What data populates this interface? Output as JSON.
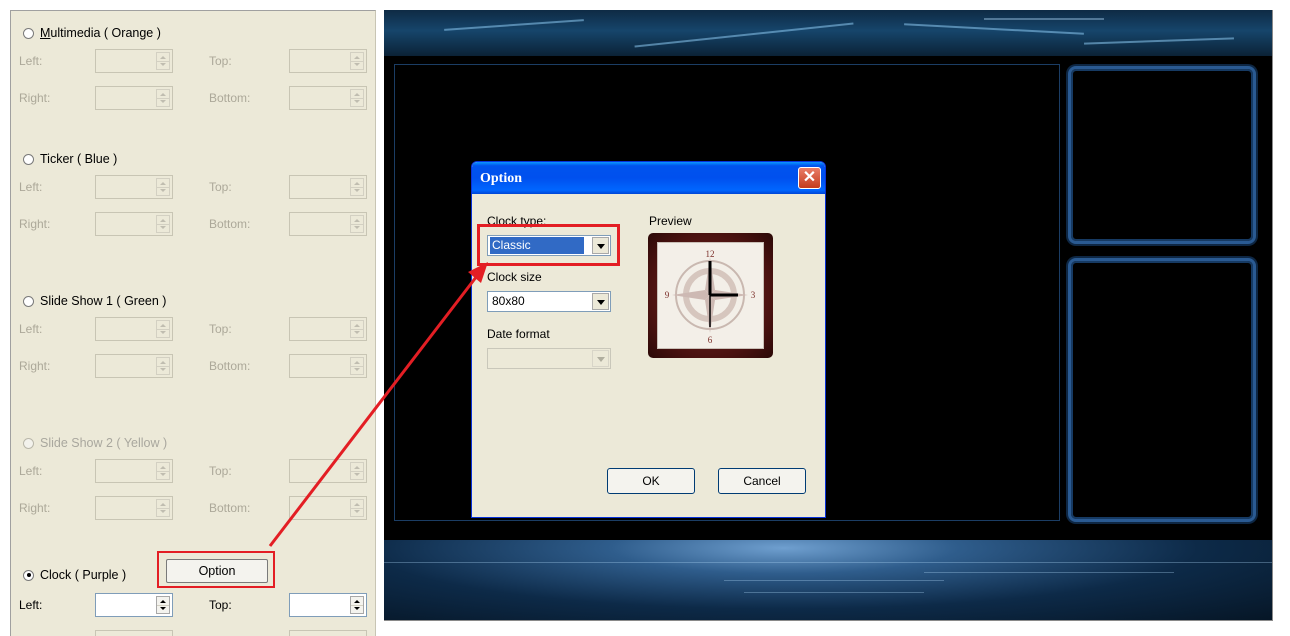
{
  "left_panel": {
    "sections": [
      {
        "label": "Multimedia ( Orange )",
        "checked": false,
        "enabled": true,
        "mnemonic": "M"
      },
      {
        "label": "Ticker ( Blue )",
        "checked": false,
        "enabled": true
      },
      {
        "label": "Slide Show 1 ( Green )",
        "checked": false,
        "enabled": true
      },
      {
        "label": "Slide Show 2 ( Yellow )",
        "checked": false,
        "enabled": false
      },
      {
        "label": "Clock ( Purple )",
        "checked": true,
        "enabled": true
      }
    ],
    "field_labels": {
      "left": "Left:",
      "top": "Top:",
      "right": "Right:",
      "bottom": "Bottom:"
    },
    "option_button": "Option"
  },
  "dialog": {
    "title": "Option",
    "close": "✕",
    "clock_type_label": "Clock type:",
    "clock_type_value": "Classic",
    "clock_size_label": "Clock size",
    "clock_size_value": "80x80",
    "date_format_label": "Date format",
    "date_format_value": "",
    "preview_label": "Preview",
    "ok": "OK",
    "cancel": "Cancel",
    "clock_numerals": {
      "twelve": "12",
      "three": "3",
      "six": "6",
      "nine": "9"
    }
  },
  "colors": {
    "highlight": "#e31e24",
    "selection": "#316ac5",
    "titlebar": "#0053ee",
    "panel": "#ece9d8"
  },
  "icons": [
    "close-icon",
    "spin-up-icon",
    "spin-down-icon",
    "dropdown-arrow-icon",
    "clock-face-icon",
    "annotation-arrow"
  ]
}
